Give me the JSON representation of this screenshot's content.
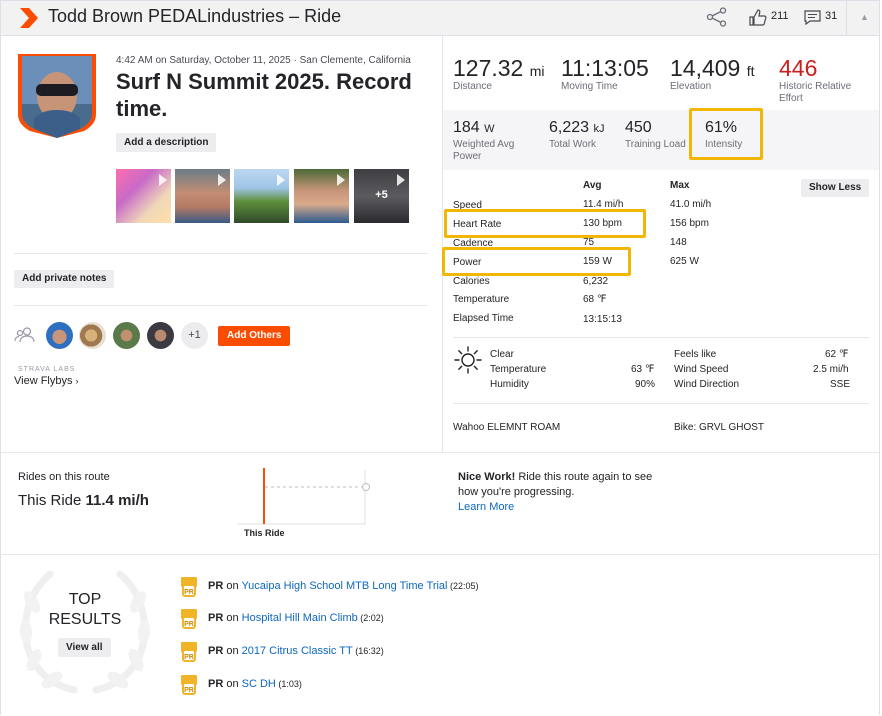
{
  "header": {
    "title": "Todd Brown PEDALindustries – Ride",
    "kudos_count": "211",
    "comment_count": "31"
  },
  "activity": {
    "meta": "4:42 AM on Saturday, October 11, 2025 · San Clemente, California",
    "title": "Surf N Summit 2025. Record time.",
    "add_description": "Add a description",
    "more_photos": "+5",
    "add_private_notes": "Add private notes",
    "others_count": "+1",
    "add_others": "Add Others",
    "labs_label": "STRAVA LABS",
    "flybys": "View Flybys"
  },
  "primary_stats": [
    {
      "value": "127.32",
      "unit": "mi",
      "label": "Distance"
    },
    {
      "value": "11:13:05",
      "unit": "",
      "label": "Moving Time"
    },
    {
      "value": "14,409",
      "unit": "ft",
      "label": "Elevation"
    },
    {
      "value": "446",
      "unit": "",
      "label": "Historic Relative Effort"
    }
  ],
  "secondary_stats": [
    {
      "value": "184",
      "unit": "W",
      "label": "Weighted Avg Power"
    },
    {
      "value": "6,223",
      "unit": "kJ",
      "label": "Total Work"
    },
    {
      "value": "450",
      "unit": "",
      "label": "Training Load"
    },
    {
      "value": "61%",
      "unit": "",
      "label": "Intensity"
    }
  ],
  "detail_table": {
    "col_avg": "Avg",
    "col_max": "Max",
    "show_less": "Show Less",
    "rows": [
      {
        "label": "Speed",
        "avg": "11.4 mi/h",
        "max": "41.0 mi/h"
      },
      {
        "label": "Heart Rate",
        "avg": "130 bpm",
        "max": "156 bpm"
      },
      {
        "label": "Cadence",
        "avg": "75",
        "max": "148"
      },
      {
        "label": "Power",
        "avg": "159 W",
        "max": "625 W"
      },
      {
        "label": "Calories",
        "avg": "6,232",
        "max": ""
      },
      {
        "label": "Temperature",
        "avg": "68 ℉",
        "max": ""
      },
      {
        "label": "Elapsed Time",
        "avg": "13:15:13",
        "max": ""
      }
    ]
  },
  "weather": {
    "condition": "Clear",
    "temperature_label": "Temperature",
    "temperature": "63 ℉",
    "humidity_label": "Humidity",
    "humidity": "90%",
    "feels_like_label": "Feels like",
    "feels_like": "62 ℉",
    "wind_speed_label": "Wind Speed",
    "wind_speed": "2.5 mi/h",
    "wind_direction_label": "Wind Direction",
    "wind_direction": "SSE"
  },
  "gear": {
    "device": "Wahoo ELEMNT ROAM",
    "bike": "Bike: GRVL GHOST"
  },
  "route": {
    "caption": "Rides on this route",
    "this_ride_label": "This Ride",
    "this_ride_value": "11.4 mi/h",
    "chart_xlabel": "This Ride",
    "nice_bold": "Nice Work!",
    "nice_text": " Ride this route again to see how you're progressing.",
    "learn_more": "Learn More"
  },
  "top_results": {
    "title_line1": "TOP",
    "title_line2": "RESULTS",
    "view_all": "View all",
    "items": [
      {
        "badge": "PR",
        "on": " on ",
        "segment": "Yucaipa High School MTB Long Time Trial",
        "time": " (22:05)"
      },
      {
        "badge": "PR",
        "on": " on ",
        "segment": "Hospital Hill Main Climb",
        "time": " (2:02)"
      },
      {
        "badge": "PR",
        "on": " on ",
        "segment": "2017 Citrus Classic TT",
        "time": " (16:32)"
      },
      {
        "badge": "PR",
        "on": " on ",
        "segment": "SC DH",
        "time": " (1:03)"
      }
    ]
  },
  "colors": {
    "brand": "#fc4c02",
    "highlight": "#f2b705",
    "link": "#0d67bd",
    "relative_effort": "#cc1f1f"
  }
}
